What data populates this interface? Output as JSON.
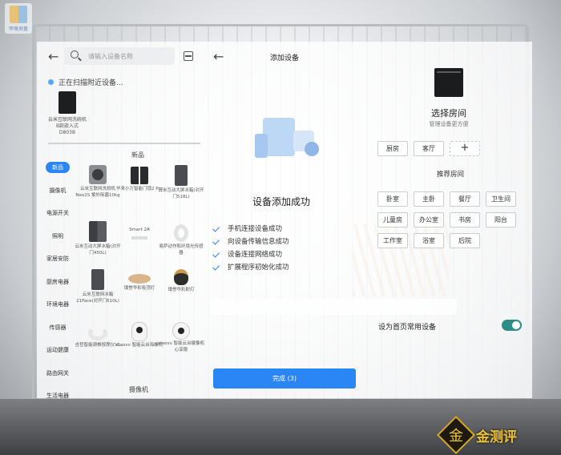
{
  "watermark_top_left": "甲角测量",
  "watermark_bottom_right": "金测评",
  "left_panel": {
    "search_placeholder": "请输入设备名称",
    "scanning_text": "正在扫描附近设备...",
    "found_device_label": "云米互联网洗碗机B款嵌入式D803B",
    "new_section_label": "新品",
    "camera_section_label": "摄像机",
    "categories": [
      "新品",
      "摄像机",
      "电源开关",
      "照明",
      "家居安防",
      "厨房电器",
      "环境电器",
      "传感器",
      "运动健康",
      "路由网关",
      "生活电器"
    ],
    "devices": [
      {
        "label": "云米互联网洗烘机Neo2S 紫外除菌10kg",
        "icon": "washer-icon"
      },
      {
        "label": "华来小万智能门锁2 Pro",
        "icon": "smart-lock-icon"
      },
      {
        "label": "云米互动大屏冰箱(对开门518L)",
        "icon": "fridge-icon"
      },
      {
        "label": "云米互动大屏冰箱(对开门450L)",
        "icon": "fridge-icon"
      },
      {
        "label": "Smart 2A",
        "icon": "ceiling-light-icon"
      },
      {
        "label": "易萨动作和环境光传感器",
        "icon": "sensor-icon"
      },
      {
        "label": "云米互联网冰箱21Face(对开门610L)",
        "icon": "fridge-icon"
      },
      {
        "label": "璞誉华彩吸顶灯",
        "icon": "ceiling-lamp-icon"
      },
      {
        "label": "璞誉华彩射灯",
        "icon": "spotlight-icon"
      },
      {
        "label": "吉哲智能颈椎按摩仪V1",
        "icon": "neck-massager-icon"
      },
      {
        "label": "xiaovv 智能云台海螺机",
        "icon": "camera-icon"
      },
      {
        "label": "xiaovv 智能云台摄像机 心享版",
        "icon": "camera-icon"
      }
    ]
  },
  "center_panel": {
    "title": "添加设备",
    "success_title": "设备添加成功",
    "steps": [
      "手机连接设备成功",
      "向设备传输信息成功",
      "设备连接网络成功",
      "扩展程序初始化成功"
    ],
    "done_button": "完成 (3)"
  },
  "right_panel": {
    "choose_room": "选择房间",
    "choose_room_sub": "管理设备更方便",
    "rooms": [
      "厨房",
      "客厅"
    ],
    "add_room": "+",
    "recommended_title": "推荐房间",
    "recommended_rooms": [
      "卧室",
      "主卧",
      "餐厅",
      "卫生间",
      "儿童房",
      "办公室",
      "书房",
      "阳台",
      "工作室",
      "浴室",
      "后院"
    ],
    "favorite_label": "设为首页常用设备",
    "favorite_on": true
  },
  "colors": {
    "accent": "#2b86f5",
    "toggle": "#2e8d86"
  }
}
